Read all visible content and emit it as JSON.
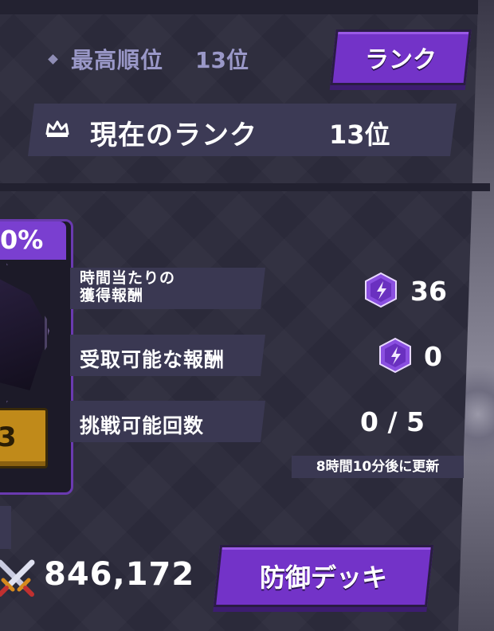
{
  "header": {
    "best_rank_label": "最高順位",
    "best_rank_value": "13位",
    "rank_button_label": "ランク",
    "current_rank_label": "現在のランク",
    "current_rank_value": "13位"
  },
  "card": {
    "percent": "0%",
    "button_glyph": "3"
  },
  "stats": {
    "hourly_reward_label": "時間当たりの\n獲得報酬",
    "hourly_reward_label_line1": "時間当たりの",
    "hourly_reward_label_line2": "獲得報酬",
    "hourly_reward_value": "36",
    "claimable_reward_label": "受取可能な報酬",
    "claimable_reward_value": "0",
    "challenge_count_label": "挑戦可能回数",
    "challenge_count_value": "0 / 5",
    "refresh_note": "8時間10分後に更新"
  },
  "footer": {
    "power_value": "846,172",
    "defense_deck_button_label": "防御デッキ"
  },
  "colors": {
    "accent_purple": "#7333c8",
    "panel_bg": "#2b2a3a",
    "label_bg": "#3a3852",
    "muted_text": "#9a98c8",
    "gold": "#c08a1a"
  },
  "icons": {
    "best_rank": "diamond-icon",
    "current_rank": "crown-icon",
    "reward_gem": "purple-lightning-gem-icon",
    "power": "crossed-swords-icon"
  }
}
